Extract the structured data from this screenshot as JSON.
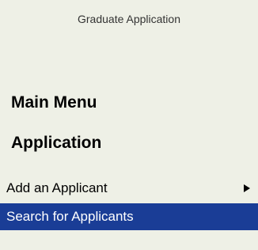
{
  "app": {
    "title": "Graduate Application"
  },
  "menu": {
    "heading_main": "Main Menu",
    "heading_application": "Application",
    "items": [
      {
        "label": "Add an Applicant",
        "has_submenu": true,
        "arrow_icon": "submenu-arrow-icon"
      },
      {
        "label": "Search for Applicants",
        "selected": true
      }
    ]
  },
  "colors": {
    "background": "#eef0e6",
    "selected_background": "#1a3d96",
    "selected_text": "#ffffff"
  }
}
